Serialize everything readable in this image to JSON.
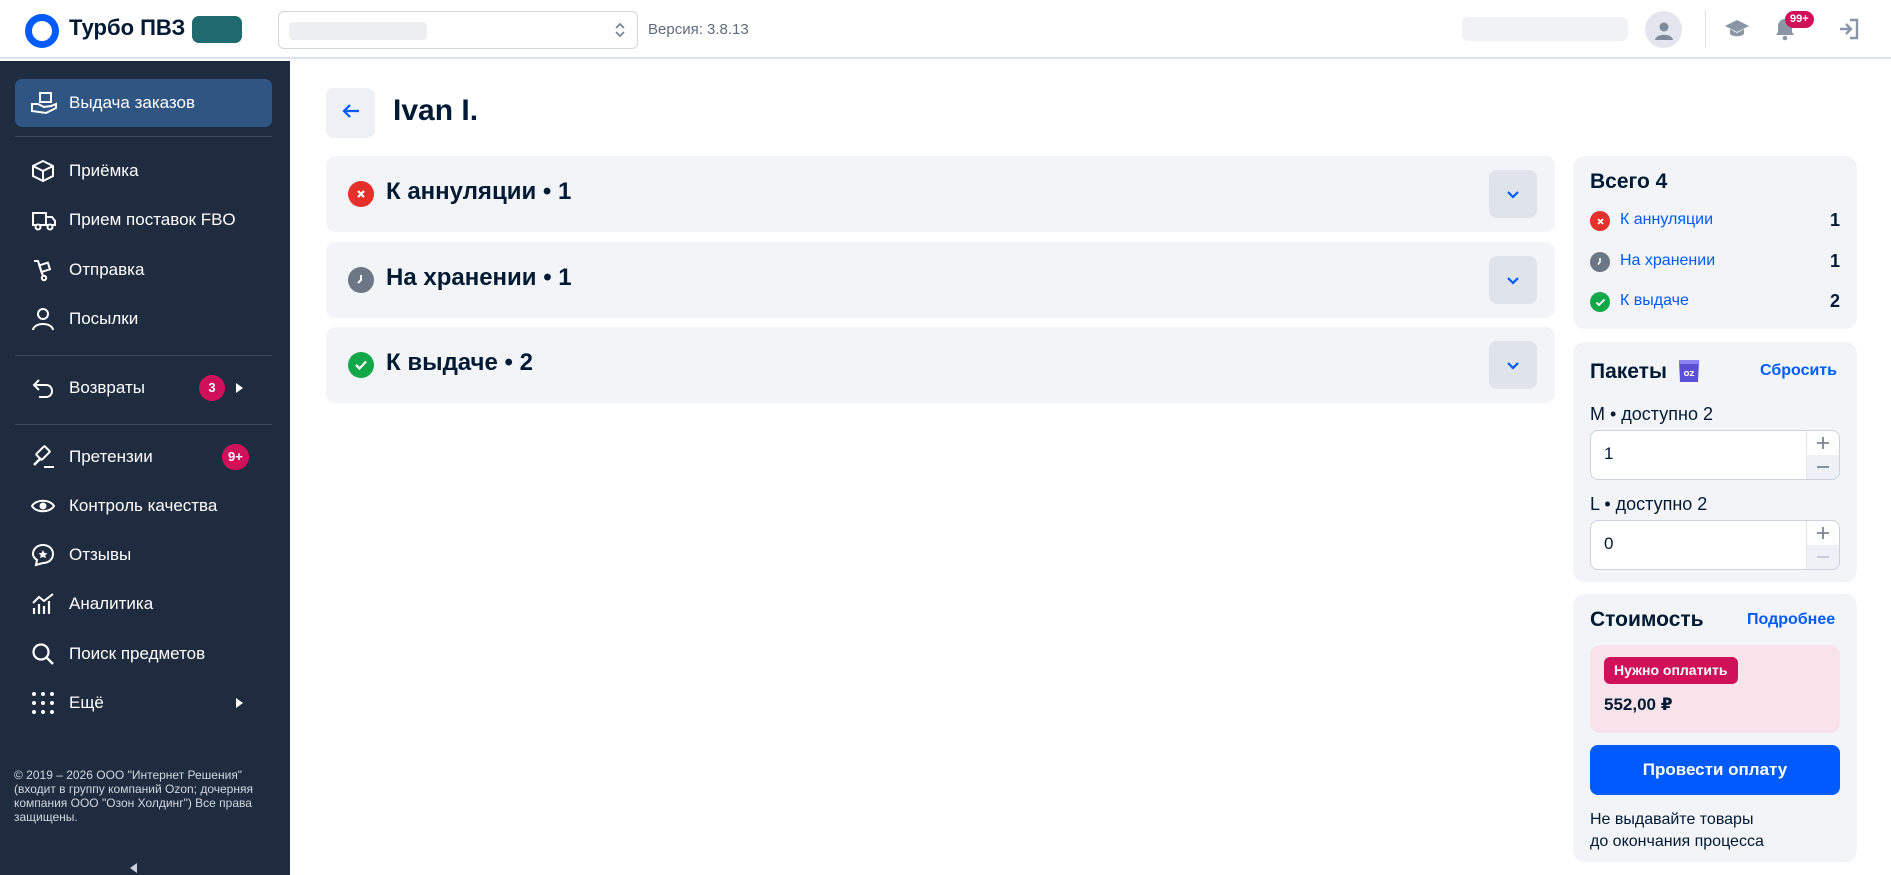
{
  "header": {
    "brand": "Турбо ПВЗ",
    "version": "Версия: 3.8.13",
    "notifications_badge": "99+",
    "icons": [
      "user-avatar-icon",
      "graduation-cap-icon",
      "bell-icon",
      "logout-icon"
    ]
  },
  "sidebar": {
    "items": [
      {
        "label": "Выдача заказов",
        "icon": "hand-with-box-icon",
        "active": true
      },
      {
        "label": "Приёмка",
        "icon": "package-box-icon"
      },
      {
        "label": "Прием поставок FBO",
        "icon": "truck-icon"
      },
      {
        "label": "Отправка",
        "icon": "hand-truck-icon"
      },
      {
        "label": "Посылки",
        "icon": "person-icon"
      },
      {
        "label": "Возвраты",
        "icon": "return-arrow-icon",
        "badge": "3"
      },
      {
        "label": "Претензии",
        "icon": "gavel-icon",
        "badge": "9+"
      },
      {
        "label": "Контроль качества",
        "icon": "eye-icon"
      },
      {
        "label": "Отзывы",
        "icon": "review-bubble-icon"
      },
      {
        "label": "Аналитика",
        "icon": "analytics-chart-icon"
      },
      {
        "label": "Поиск предметов",
        "icon": "search-icon"
      },
      {
        "label": "Ещё",
        "icon": "grid-dots-icon"
      }
    ],
    "copyright": "© 2019 – 2026 ООО \"Интернет Решения\" (входит в группу компаний Ozon; дочерняя компания ООО \"Озон Холдинг\") Все права защищены."
  },
  "main": {
    "title": "Ivan I.",
    "groups": [
      {
        "title": "К аннуляции • 1",
        "status": "cancel"
      },
      {
        "title": "На хранении • 1",
        "status": "storage"
      },
      {
        "title": "К выдаче • 2",
        "status": "ready"
      }
    ]
  },
  "summary": {
    "title": "Всего 4",
    "rows": [
      {
        "label": "К аннуляции",
        "count": "1",
        "status": "cancel"
      },
      {
        "label": "На хранении",
        "count": "1",
        "status": "storage"
      },
      {
        "label": "К выдаче",
        "count": "2",
        "status": "ready"
      }
    ]
  },
  "packages": {
    "title": "Пакеты",
    "reset": "Сбросить",
    "sizes": [
      {
        "label": "M • доступно 2",
        "value": "1"
      },
      {
        "label": "L • доступно 2",
        "value": "0"
      }
    ]
  },
  "cost": {
    "title": "Стоимость",
    "details": "Подробнее",
    "badge": "Нужно оплатить",
    "amount": "552,00 ₽",
    "pay_button": "Провести оплату",
    "note_line1": "Не выдавайте товары",
    "note_line2": "до окончания процесса"
  },
  "colors": {
    "accent": "#005bff",
    "sidebar_bg": "#1f2b3f",
    "sidebar_active": "#2f5582",
    "badge": "#d1105a",
    "cancel": "#e5302c",
    "storage": "#6b7785",
    "ready": "#12a84a"
  }
}
